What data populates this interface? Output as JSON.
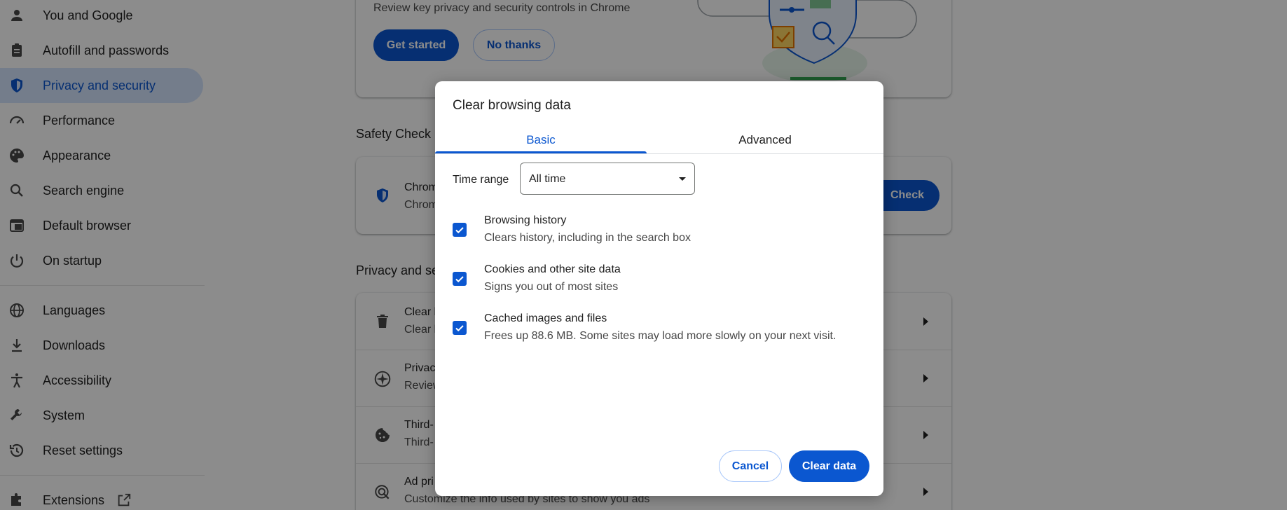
{
  "sidebar": {
    "items": [
      {
        "label": "You and Google",
        "icon": "person-icon"
      },
      {
        "label": "Autofill and passwords",
        "icon": "clipboard-icon"
      },
      {
        "label": "Privacy and security",
        "icon": "shield-icon",
        "active": true
      },
      {
        "label": "Performance",
        "icon": "speedometer-icon"
      },
      {
        "label": "Appearance",
        "icon": "palette-icon"
      },
      {
        "label": "Search engine",
        "icon": "search-icon"
      },
      {
        "label": "Default browser",
        "icon": "browser-window-icon"
      },
      {
        "label": "On startup",
        "icon": "power-icon"
      }
    ],
    "items2": [
      {
        "label": "Languages",
        "icon": "globe-icon"
      },
      {
        "label": "Downloads",
        "icon": "download-icon"
      },
      {
        "label": "Accessibility",
        "icon": "accessibility-icon"
      },
      {
        "label": "System",
        "icon": "wrench-icon"
      },
      {
        "label": "Reset settings",
        "icon": "history-icon"
      }
    ],
    "extensions": {
      "label": "Extensions",
      "icon": "puzzle-icon",
      "external_icon": "open-in-new-icon"
    }
  },
  "guide_card": {
    "description": "Review key privacy and security controls in Chrome",
    "get_started": "Get started",
    "no_thanks": "No thanks"
  },
  "safety_check": {
    "title": "Safety Check",
    "row_title_fragment": "Chrom",
    "row_desc_fragment": "Chrom",
    "button_fragment": "Check"
  },
  "privacy_section": {
    "title_fragment": "Privacy and se",
    "rows": [
      {
        "title": "Clear b",
        "desc": "Clear h",
        "icon": "trash-icon"
      },
      {
        "title": "Privac",
        "desc": "Review",
        "icon": "compass-icon"
      },
      {
        "title": "Third-",
        "desc": "Third-",
        "icon": "cookie-icon"
      },
      {
        "title": "Ad pri",
        "desc": "Customize the info used by sites to show you ads",
        "icon": "ad-privacy-icon"
      }
    ]
  },
  "dialog": {
    "title": "Clear browsing data",
    "tabs": {
      "basic": "Basic",
      "advanced": "Advanced"
    },
    "time_range": {
      "label": "Time range",
      "value": "All time"
    },
    "options": [
      {
        "title": "Browsing history",
        "desc": "Clears history, including in the search box",
        "checked": true
      },
      {
        "title": "Cookies and other site data",
        "desc": "Signs you out of most sites",
        "checked": true
      },
      {
        "title": "Cached images and files",
        "desc": "Frees up 88.6 MB. Some sites may load more slowly on your next visit.",
        "checked": true
      }
    ],
    "cancel": "Cancel",
    "clear": "Clear data"
  },
  "colors": {
    "accent": "#0b57d0",
    "active_nav_bg": "#d3e3fd",
    "scrim": "rgba(0,0,0,0.45)"
  }
}
